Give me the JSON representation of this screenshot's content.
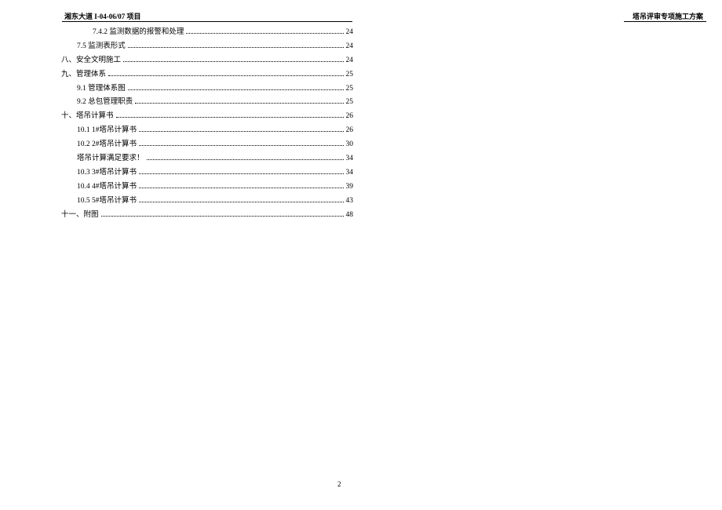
{
  "header": {
    "left": "湘东大道 I-04-06/07 项目",
    "right": "塔吊评审专项施工方案"
  },
  "toc": [
    {
      "indent": 2,
      "label": "7.4.2 监测数据的报警和处理",
      "page": "24"
    },
    {
      "indent": 1,
      "label": "7.5 监测表形式",
      "page": "24"
    },
    {
      "indent": 0,
      "label": "八、安全文明施工",
      "page": "24"
    },
    {
      "indent": 0,
      "label": "九、管理体系",
      "page": "25"
    },
    {
      "indent": 1,
      "label": "9.1 管理体系图",
      "page": "25"
    },
    {
      "indent": 1,
      "label": "9.2 总包管理职责",
      "page": "25"
    },
    {
      "indent": 0,
      "label": "十、塔吊计算书",
      "page": "26"
    },
    {
      "indent": 1,
      "label": "10.1 1#塔吊计算书",
      "page": "26"
    },
    {
      "indent": 1,
      "label": "10.2 2#塔吊计算书",
      "page": "30"
    },
    {
      "indent": 1,
      "label": "塔吊计算满足要求！",
      "page": "34"
    },
    {
      "indent": 1,
      "label": "10.3 3#塔吊计算书",
      "page": "34"
    },
    {
      "indent": 1,
      "label": "10.4 4#塔吊计算书",
      "page": "39"
    },
    {
      "indent": 1,
      "label": "10.5 5#塔吊计算书",
      "page": "43"
    },
    {
      "indent": 0,
      "label": "十一、附图",
      "page": "48"
    }
  ],
  "pageNumber": "2"
}
